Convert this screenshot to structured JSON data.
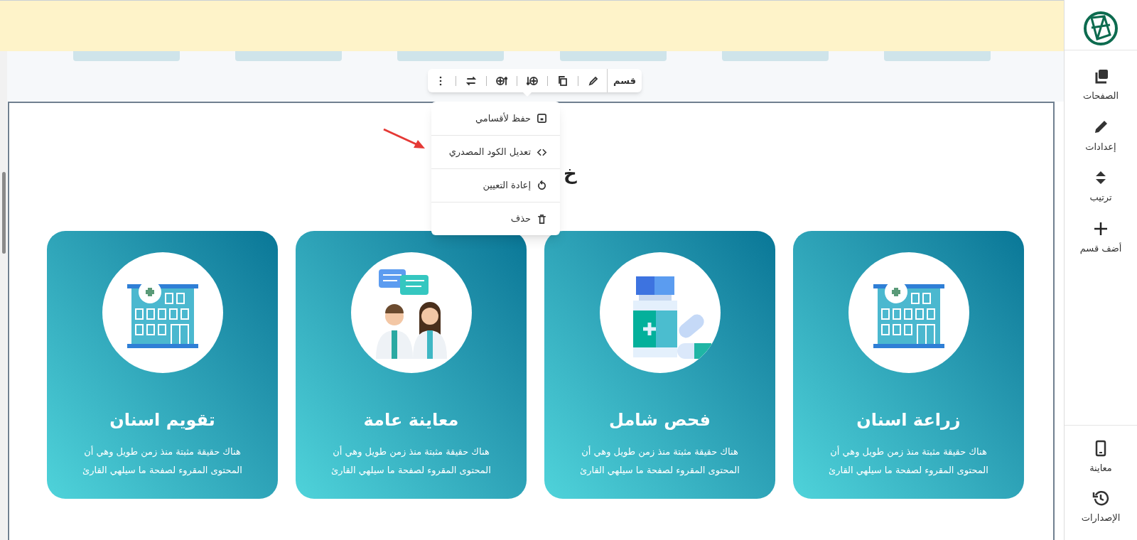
{
  "sidebar": {
    "items": [
      {
        "kind": "pages",
        "label": "الصفحات"
      },
      {
        "kind": "settings",
        "label": "إعدادات"
      },
      {
        "kind": "sort",
        "label": "ترتيب"
      },
      {
        "kind": "add",
        "label": "أضف قسم"
      }
    ],
    "bottom_items": [
      {
        "kind": "mobile",
        "label": "معاينة"
      },
      {
        "kind": "history",
        "label": "الإصدارات"
      }
    ]
  },
  "toolbar": {
    "label": "قسم",
    "tools": [
      {
        "kind": "edit"
      },
      {
        "kind": "copy"
      },
      {
        "kind": "add-below"
      },
      {
        "kind": "add-above"
      },
      {
        "kind": "swap"
      },
      {
        "kind": "more"
      }
    ]
  },
  "menu": {
    "items": [
      {
        "kind": "save",
        "label": "حفظ لأقسامي"
      },
      {
        "kind": "code",
        "label": "تعديل الكود المصدري"
      },
      {
        "kind": "reset",
        "label": "إعادة التعيين"
      },
      {
        "kind": "delete",
        "label": "حذف"
      }
    ]
  },
  "heading": "خ",
  "cards": [
    {
      "kind": "building",
      "title": "زراعة اسنان",
      "text": "هناك حقيقة مثبتة منذ زمن طويل وهي أن المحتوى المقروء لصفحة ما سيلهي القارئ"
    },
    {
      "kind": "medicine",
      "title": "فحص شامل",
      "text": "هناك حقيقة مثبتة منذ زمن طويل وهي أن المحتوى المقروء لصفحة ما سيلهي القارئ"
    },
    {
      "kind": "doctors",
      "title": "معاينة عامة",
      "text": "هناك حقيقة مثبتة منذ زمن طويل وهي أن المحتوى المقروء لصفحة ما سيلهي القارئ"
    },
    {
      "kind": "building",
      "title": "تقويم اسنان",
      "text": "هناك حقيقة مثبتة منذ زمن طويل وهي أن المحتوى المقروء لصفحة ما سيلهي القارئ"
    }
  ]
}
